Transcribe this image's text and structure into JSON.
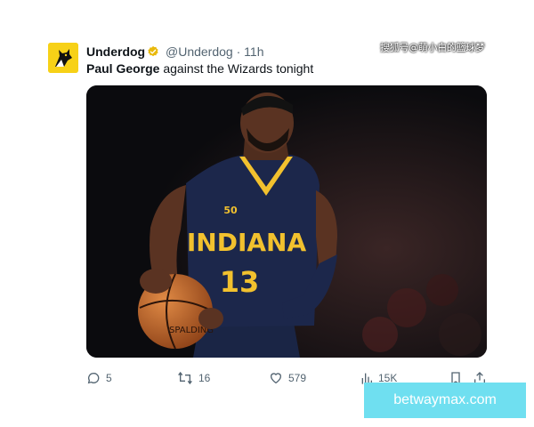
{
  "tweet": {
    "display_name": "Underdog",
    "handle": "@Underdog",
    "separator": "·",
    "time": "11h",
    "text_bold": "Paul George",
    "text_rest": " against the Wizards tonight",
    "avatar_icon": "underdog-dog-logo",
    "avatar_color": "#f7d117",
    "verified_color": "#e9b90b",
    "jersey": {
      "team": "INDIANA",
      "number": "13",
      "patch": "50",
      "ball_brand": "SPALDING"
    }
  },
  "actions": {
    "replies": "5",
    "reposts": "16",
    "likes": "579",
    "views": "15K",
    "icons": [
      "reply-icon",
      "repost-icon",
      "like-icon",
      "views-icon",
      "bookmark-icon",
      "share-icon"
    ]
  },
  "watermark": "搜狐号@萌小白的篮球梦",
  "ad": {
    "text": "betwaymax.com",
    "color": "#6fdff0"
  }
}
